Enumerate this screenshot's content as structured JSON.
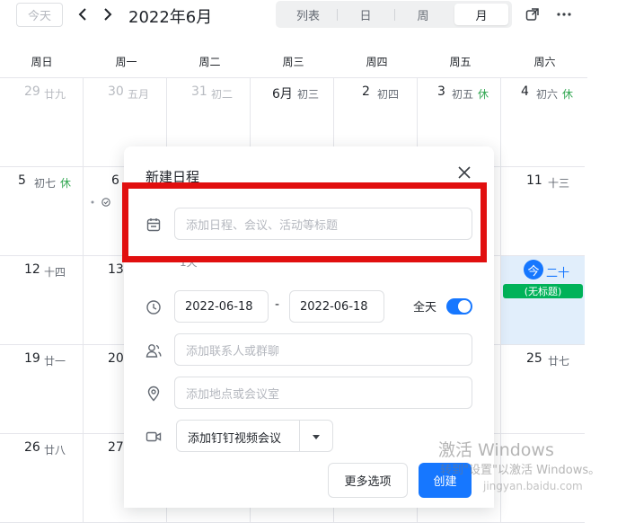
{
  "toolbar": {
    "today": "今天",
    "month_title": "2022年6月",
    "views": [
      "列表",
      "日",
      "周",
      "月"
    ],
    "active_view": "月"
  },
  "weekdays": [
    "周日",
    "周一",
    "周二",
    "周三",
    "周四",
    "周五",
    "周六"
  ],
  "weeks": [
    [
      {
        "num": "29",
        "lunar": "廿九",
        "dim": true
      },
      {
        "num": "30",
        "lunar": "五月",
        "dim": true
      },
      {
        "num": "31",
        "lunar": "初二",
        "dim": true
      },
      {
        "num": "6月",
        "lunar": "初三"
      },
      {
        "num": "2",
        "lunar": "初四"
      },
      {
        "num": "3",
        "lunar": "初五",
        "rest": "休"
      },
      {
        "num": "4",
        "lunar": "初六",
        "rest": "休"
      }
    ],
    [
      {
        "num": "5",
        "lunar": "初七",
        "rest": "休"
      },
      {
        "num": "6",
        "lunar": ""
      },
      {
        "num": "",
        "lunar": ""
      },
      {
        "num": "",
        "lunar": ""
      },
      {
        "num": "",
        "lunar": ""
      },
      {
        "num": "",
        "lunar": ""
      },
      {
        "num": "11",
        "lunar": "十三"
      }
    ],
    [
      {
        "num": "12",
        "lunar": "十四"
      },
      {
        "num": "13",
        "lunar": ""
      },
      {
        "num": "",
        "lunar": ""
      },
      {
        "num": "",
        "lunar": ""
      },
      {
        "num": "",
        "lunar": ""
      },
      {
        "num": "",
        "lunar": ""
      },
      {
        "num": "今",
        "lunar": "二十",
        "today": true,
        "event": "(无标题)"
      }
    ],
    [
      {
        "num": "19",
        "lunar": "廿一"
      },
      {
        "num": "20",
        "lunar": ""
      },
      {
        "num": "",
        "lunar": ""
      },
      {
        "num": "",
        "lunar": ""
      },
      {
        "num": "",
        "lunar": ""
      },
      {
        "num": "",
        "lunar": ""
      },
      {
        "num": "25",
        "lunar": "廿七"
      }
    ],
    [
      {
        "num": "26",
        "lunar": "廿八"
      },
      {
        "num": "27",
        "lunar": ""
      },
      {
        "num": "",
        "lunar": ""
      },
      {
        "num": "",
        "lunar": ""
      },
      {
        "num": "",
        "lunar": ""
      },
      {
        "num": "",
        "lunar": ""
      },
      {
        "num": "",
        "lunar": ""
      }
    ]
  ],
  "modal": {
    "title": "新建日程",
    "title_placeholder": "添加日程、会议、活动等标题",
    "partial_hidden_text": "1天",
    "start_date": "2022-06-18",
    "date_separator": "-",
    "end_date": "2022-06-18",
    "all_day_label": "全天",
    "all_day_on": true,
    "contacts_placeholder": "添加联系人或群聊",
    "location_placeholder": "添加地点或会议室",
    "video_meeting_label": "添加钉钉视频会议",
    "more_options": "更多选项",
    "create": "创建"
  },
  "colors": {
    "accent": "#1677ff",
    "event_green": "#00b259",
    "rest_green": "#34a853",
    "highlight_box": "#e10f0f"
  },
  "watermark": {
    "line1": "激活 Windows",
    "line2": "转到\"设置\"以激活 Windows。",
    "url": "jingyan.baidu.com"
  }
}
